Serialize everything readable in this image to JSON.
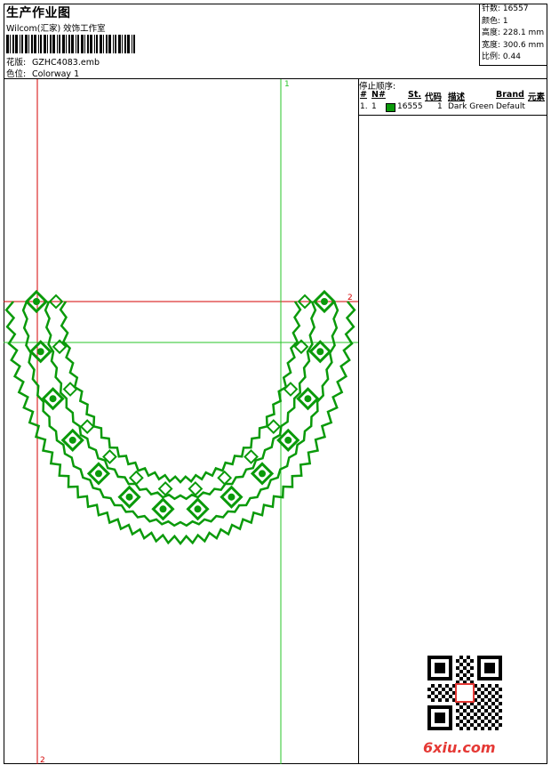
{
  "header": {
    "title": "生产作业图",
    "subtitle": "Wilcom(汇家) 效饰工作室",
    "design_label": "花版:",
    "design_value": "GZHC4083.emb",
    "colorway_label": "色位:",
    "colorway_value": "Colorway 1"
  },
  "stats": {
    "stitches_label": "针数:",
    "stitches_value": "16557",
    "colors_label": "颜色:",
    "colors_value": "1",
    "height_label": "高度:",
    "height_value": "228.1 mm",
    "width_label": "宽度:",
    "width_value": "300.6 mm",
    "scale_label": "比例:",
    "scale_value": "0.44"
  },
  "guides": {
    "top_marker": "1",
    "right_marker": "2",
    "bottom_marker": "2",
    "guide_color_red": "#d40000",
    "guide_color_green": "#27c427"
  },
  "stop_sequence": {
    "title": "停止顺序:",
    "columns": [
      "#",
      "N#",
      "St.",
      "代码",
      "描述",
      "Brand",
      "元素"
    ],
    "rows": [
      {
        "num": "1.",
        "needle": "1",
        "stitches": "16555",
        "code": "1",
        "description": "Dark Green",
        "brand": "Default",
        "color": "#0a9a0a"
      }
    ]
  },
  "embroidery": {
    "color": "#0a9a0a"
  },
  "watermark": "6xiu.com"
}
